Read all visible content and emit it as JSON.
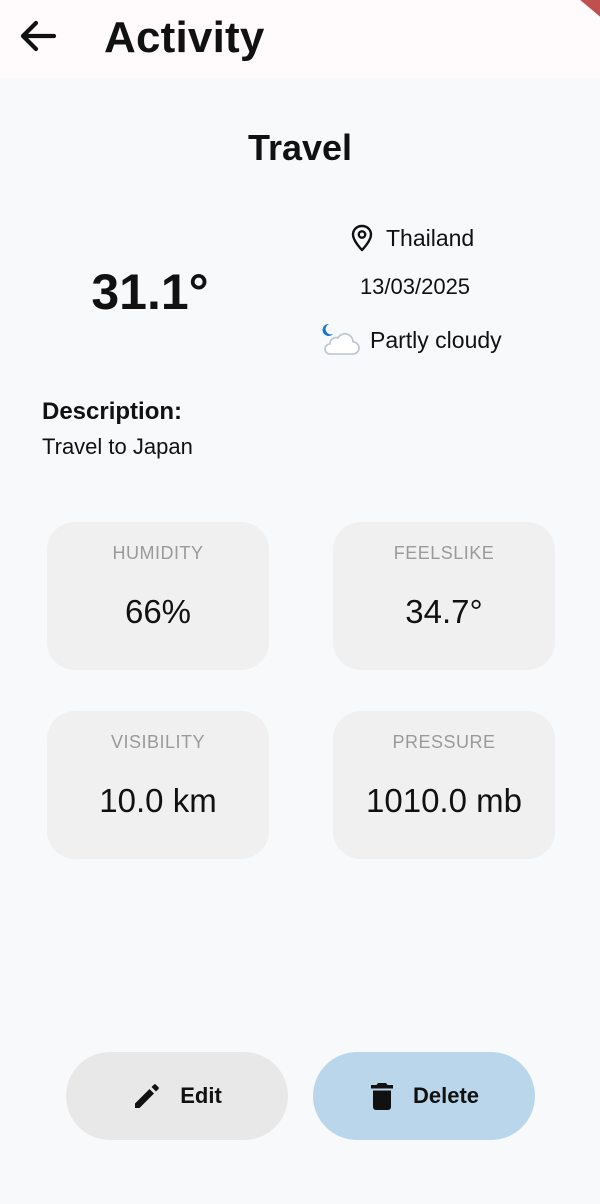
{
  "appbar": {
    "title": "Activity",
    "back_icon": "arrow-left-icon"
  },
  "activity": {
    "name": "Travel",
    "temperature": "31.1°",
    "location": "Thailand",
    "date": "13/03/2025",
    "condition": "Partly cloudy",
    "location_icon": "map-pin-icon",
    "condition_icon": "partly-cloudy-night-icon"
  },
  "description": {
    "label": "Description:",
    "text": "Travel to Japan"
  },
  "stats": [
    {
      "label": "HUMIDITY",
      "value": "66%"
    },
    {
      "label": "FEELSLIKE",
      "value": "34.7°"
    },
    {
      "label": "VISIBILITY",
      "value": "10.0 km"
    },
    {
      "label": "PRESSURE",
      "value": "1010.0 mb"
    }
  ],
  "actions": {
    "edit_label": "Edit",
    "delete_label": "Delete",
    "edit_icon": "pencil-icon",
    "delete_icon": "trash-icon"
  },
  "colors": {
    "app_background": "#f8f9fa",
    "appbar_background": "#fffbfd",
    "card_background": "#f0f0f0",
    "edit_button": "#e8e8e8",
    "delete_button": "#b9d6ea",
    "stat_label": "#9a9a9a",
    "moon_icon": "#1976d2"
  }
}
